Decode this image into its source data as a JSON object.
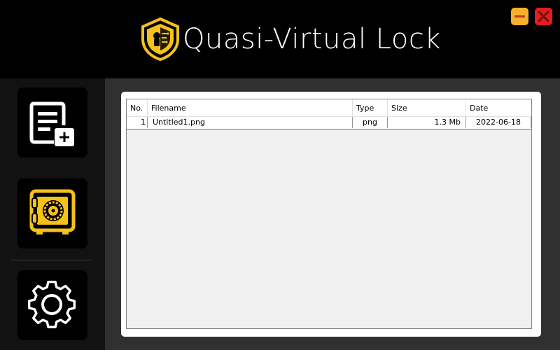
{
  "header": {
    "title": "Quasi-Virtual Lock",
    "logo_icon": "shield-lock-icon",
    "minimize_icon": "minimize-icon",
    "close_icon": "close-icon",
    "colors": {
      "accent": "#f6c11a",
      "minimize": "#f6b12b",
      "close": "#e51d1d"
    }
  },
  "sidebar": {
    "items": [
      {
        "name": "add-file",
        "icon": "file-add-icon"
      },
      {
        "name": "vault",
        "icon": "safe-icon"
      },
      {
        "name": "settings",
        "icon": "gear-icon"
      }
    ]
  },
  "table": {
    "columns": [
      "No.",
      "Filename",
      "Type",
      "Size",
      "Date"
    ],
    "rows": [
      {
        "no": "1",
        "filename": "Untitled1.png",
        "type": "png",
        "size": "1.3 Mb",
        "date": "2022-06-18"
      }
    ]
  }
}
